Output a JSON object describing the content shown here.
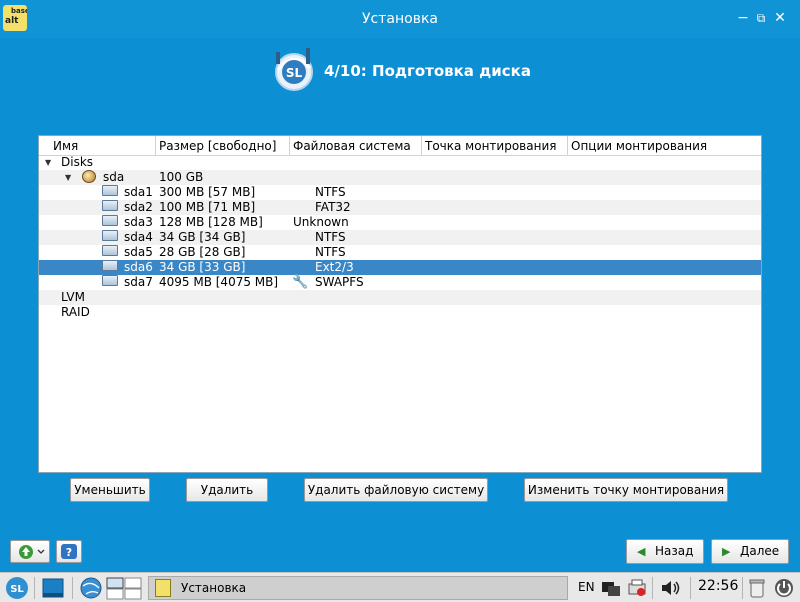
{
  "window": {
    "title": "Установка"
  },
  "step": {
    "title": "4/10: Подготовка диска"
  },
  "tree": {
    "columns": [
      "Имя",
      "Размер [свободно]",
      "Файловая система",
      "Точка монтирования",
      "Опции монтирования"
    ],
    "rows": [
      {
        "name": "Disks",
        "size": "",
        "fs": ""
      },
      {
        "name": "sda",
        "size": "100 GB",
        "fs": ""
      },
      {
        "name": "sda1",
        "size": "300 MB [57 MB]",
        "fs": "NTFS"
      },
      {
        "name": "sda2",
        "size": "100 MB [71 MB]",
        "fs": "FAT32"
      },
      {
        "name": "sda3",
        "size": "128 MB [128 MB]",
        "fs": "Unknown"
      },
      {
        "name": "sda4",
        "size": "34 GB [34 GB]",
        "fs": "NTFS"
      },
      {
        "name": "sda5",
        "size": "28 GB [28 GB]",
        "fs": "NTFS"
      },
      {
        "name": "sda6",
        "size": "34 GB [33 GB]",
        "fs": "Ext2/3"
      },
      {
        "name": "sda7",
        "size": "4095 MB [4075 MB]",
        "fs": "SWAPFS"
      },
      {
        "name": "LVM",
        "size": "",
        "fs": ""
      },
      {
        "name": "RAID",
        "size": "",
        "fs": ""
      }
    ]
  },
  "actions": {
    "shrink": "Уменьшить",
    "delete": "Удалить",
    "delete_fs": "Удалить файловую систему",
    "change_mount": "Изменить точку монтирования"
  },
  "nav": {
    "back": "Назад",
    "next": "Далее"
  },
  "logo_text": "SL",
  "taskbar": {
    "task_title": "Установка",
    "lang": "EN",
    "clock": "22:56"
  },
  "colors": {
    "accent": "#0d8fd4",
    "selection": "#3a87c7"
  }
}
